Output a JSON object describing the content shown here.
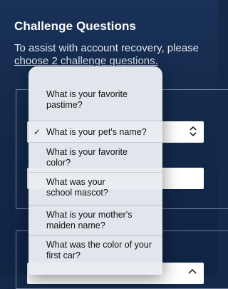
{
  "header": {
    "title": "Challenge Questions",
    "subtitle_line1": "To assist with account recovery, please",
    "subtitle_line2": "choose 2 challenge questions."
  },
  "form": {
    "question1_selected": "What is your pet's name?",
    "question2_selected": ""
  },
  "menu": {
    "items": [
      {
        "label": "What is your favorite pastime?",
        "selected": false
      },
      {
        "label": "What is your pet's name?",
        "selected": true
      },
      {
        "label": "What is your favorite color?",
        "selected": false
      },
      {
        "label": "What was your school mascot?",
        "selected": false
      },
      {
        "label": "What is your mother's maiden name?",
        "selected": false
      },
      {
        "label": "What was the color of your first car?",
        "selected": false
      }
    ],
    "check_glyph": "✓"
  },
  "icons": {
    "select_chevron": "chevron-up-down-icon",
    "chevron_up": "chevron-up-icon"
  },
  "colors": {
    "background": "#15294a",
    "menu": "#e8ecf2"
  }
}
